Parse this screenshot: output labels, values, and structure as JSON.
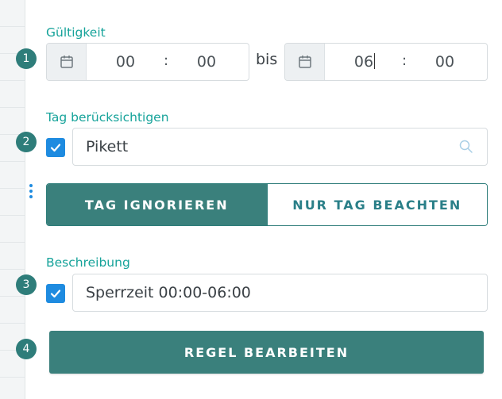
{
  "validity": {
    "label": "Gültigkeit",
    "step": "1",
    "from": {
      "hours": "00",
      "separator": ":",
      "minutes": "00"
    },
    "to_label": "bis",
    "to": {
      "hours": "06",
      "separator": ":",
      "minutes": "00"
    }
  },
  "tag": {
    "label": "Tag berücksichtigen",
    "step": "2",
    "checked": true,
    "value": "Pikett",
    "mode": {
      "options": [
        "TAG IGNORIEREN",
        "NUR TAG BEACHTEN"
      ],
      "selected": "TAG IGNORIEREN"
    }
  },
  "description": {
    "label": "Beschreibung",
    "step": "3",
    "checked": true,
    "value": "Sperrzeit 00:00-06:00"
  },
  "submit": {
    "step": "4",
    "label": "REGEL BEARBEITEN"
  },
  "colors": {
    "accent": "#16a39a",
    "primary": "#3a807c",
    "checkbox": "#1e8be0"
  },
  "icons": [
    "calendar-icon",
    "check-icon",
    "search-icon"
  ]
}
